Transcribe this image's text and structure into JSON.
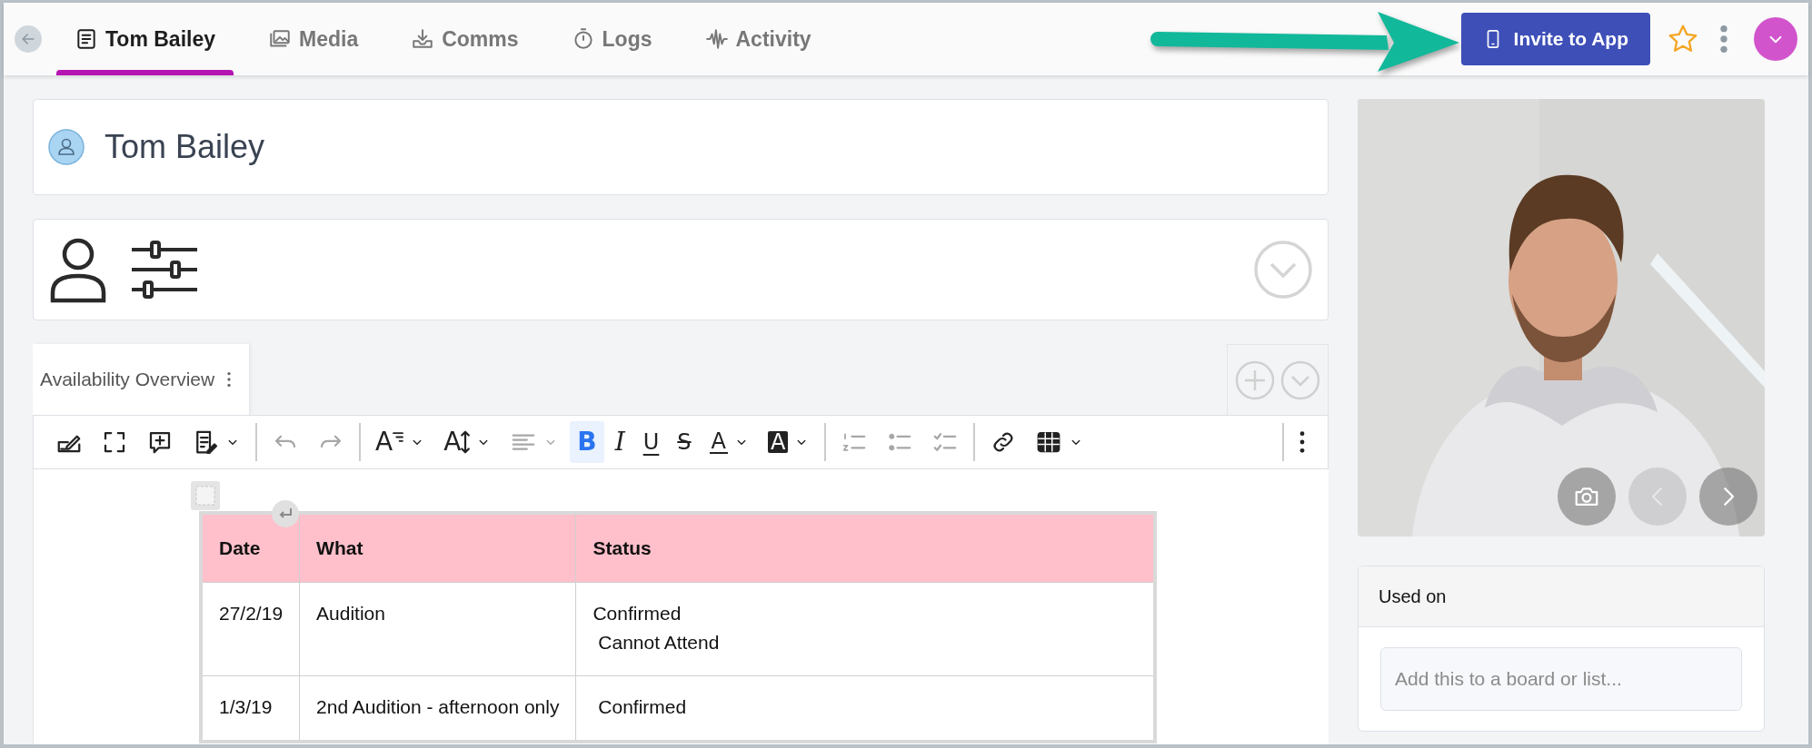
{
  "topbar": {
    "tabs": [
      {
        "kind": "profile",
        "label": "Tom Bailey",
        "selected": true
      },
      {
        "kind": "media",
        "label": "Media",
        "selected": false
      },
      {
        "kind": "comms",
        "label": "Comms",
        "selected": false
      },
      {
        "kind": "logs",
        "label": "Logs",
        "selected": false
      },
      {
        "kind": "activity",
        "label": "Activity",
        "selected": false
      }
    ],
    "invite_button": "Invite to App",
    "favorite": false
  },
  "profile": {
    "name": "Tom Bailey"
  },
  "editor": {
    "tab": "Availability Overview",
    "toolbar": [
      [
        {
          "kind": "signature",
          "selected": false,
          "disabled": false,
          "dropdown": false
        },
        {
          "kind": "fullscreen",
          "selected": false,
          "disabled": false,
          "dropdown": false
        },
        {
          "kind": "comment",
          "selected": false,
          "disabled": false,
          "dropdown": false
        },
        {
          "kind": "doc",
          "selected": false,
          "disabled": false,
          "dropdown": true
        }
      ],
      [
        {
          "kind": "undo",
          "selected": false,
          "disabled": true,
          "dropdown": false
        },
        {
          "kind": "redo",
          "selected": false,
          "disabled": true,
          "dropdown": false
        }
      ],
      [
        {
          "kind": "font-style",
          "glyph": "A",
          "selected": false,
          "disabled": false,
          "dropdown": true
        },
        {
          "kind": "font-size",
          "glyph": "A",
          "selected": false,
          "disabled": false,
          "dropdown": true
        },
        {
          "kind": "align",
          "selected": false,
          "disabled": true,
          "dropdown": true
        },
        {
          "kind": "bold",
          "glyph": "B",
          "selected": true,
          "disabled": false,
          "dropdown": false
        },
        {
          "kind": "italic",
          "glyph": "I",
          "selected": false,
          "disabled": false,
          "dropdown": false
        },
        {
          "kind": "underline",
          "glyph": "U",
          "selected": false,
          "disabled": false,
          "dropdown": false
        },
        {
          "kind": "strike",
          "glyph": "S",
          "selected": false,
          "disabled": false,
          "dropdown": false
        },
        {
          "kind": "font-color",
          "glyph": "A",
          "selected": false,
          "disabled": false,
          "dropdown": true
        },
        {
          "kind": "highlight",
          "glyph": "A",
          "selected": false,
          "disabled": false,
          "dropdown": true
        }
      ],
      [
        {
          "kind": "ordered-list",
          "selected": false,
          "disabled": true,
          "dropdown": false
        },
        {
          "kind": "bullet-list",
          "selected": false,
          "disabled": true,
          "dropdown": false
        },
        {
          "kind": "checklist",
          "selected": false,
          "disabled": true,
          "dropdown": false
        }
      ],
      [
        {
          "kind": "link",
          "selected": false,
          "disabled": false,
          "dropdown": false
        },
        {
          "kind": "table",
          "selected": false,
          "disabled": false,
          "dropdown": true
        }
      ],
      [
        {
          "kind": "more",
          "selected": false,
          "disabled": false,
          "dropdown": false
        }
      ]
    ],
    "table": {
      "columns": [
        "Date",
        "What",
        "Status"
      ],
      "rows": [
        {
          "date": "27/2/19",
          "what": "Audition",
          "status": [
            "Confirmed",
            " Cannot Attend"
          ]
        },
        {
          "date": "1/3/19",
          "what": "2nd Audition - afternoon only",
          "status": [
            " Confirmed"
          ]
        }
      ]
    }
  },
  "photo": {
    "kind": "picture",
    "previous_disabled": true,
    "next_disabled": false
  },
  "used_on": {
    "title": "Used on",
    "placeholder": "Add this to a board or list..."
  }
}
